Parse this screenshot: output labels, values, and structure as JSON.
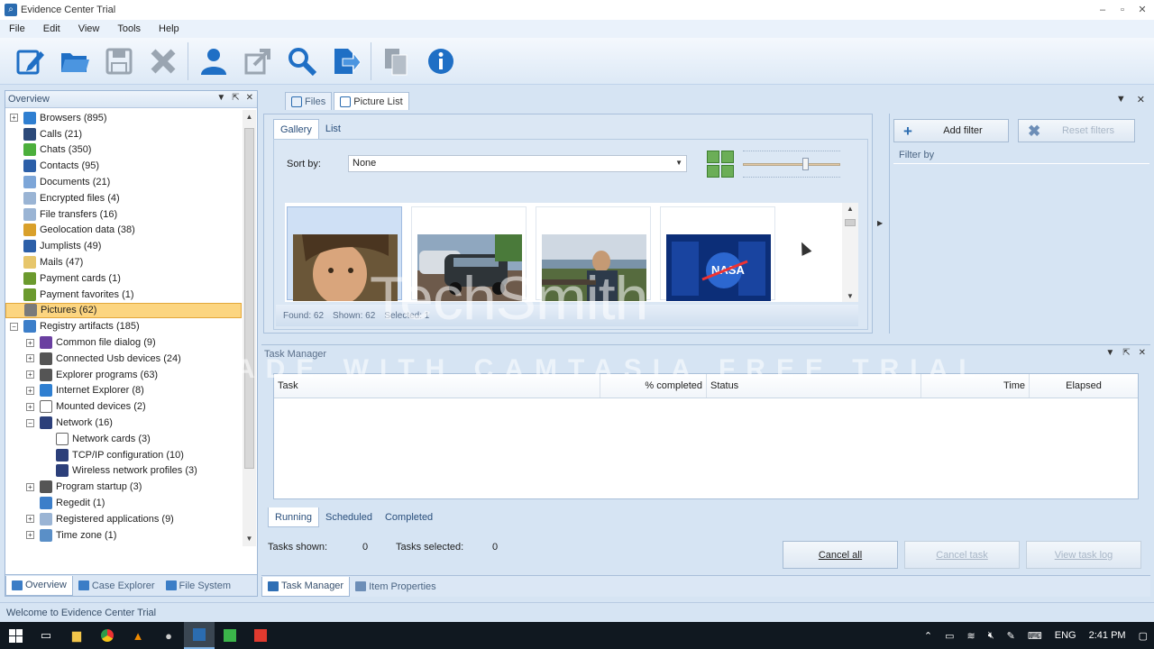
{
  "window": {
    "title": "Evidence Center Trial"
  },
  "menu": [
    "File",
    "Edit",
    "View",
    "Tools",
    "Help"
  ],
  "toolbar": {
    "buttons": [
      {
        "icon": "new-case-icon",
        "color": "#1f6fc5"
      },
      {
        "icon": "open-folder-icon",
        "color": "#1f6fc5"
      },
      {
        "icon": "save-icon",
        "color": "#9aa5b1"
      },
      {
        "icon": "close-x-icon",
        "color": "#9aa5b1"
      },
      {
        "icon": "user-icon",
        "color": "#1f6fc5"
      },
      {
        "icon": "export-icon",
        "color": "#9aa5b1"
      },
      {
        "icon": "search-icon",
        "color": "#1f6fc5"
      },
      {
        "icon": "report-icon",
        "color": "#1f6fc5"
      },
      {
        "icon": "copy-icon",
        "color": "#9aa5b1"
      },
      {
        "icon": "info-icon",
        "color": "#1f6fc5"
      }
    ]
  },
  "overview": {
    "title": "Overview",
    "items": [
      {
        "label": "Browsers (895)",
        "level": 0,
        "expander": "+",
        "icon": "globe-icon",
        "color": "#2f7fd1"
      },
      {
        "label": "Calls (21)",
        "level": 0,
        "expander": "",
        "icon": "phone-icon",
        "color": "#2c4a7a"
      },
      {
        "label": "Chats (350)",
        "level": 0,
        "expander": "",
        "icon": "chat-icon",
        "color": "#4caf3c"
      },
      {
        "label": "Contacts (95)",
        "level": 0,
        "expander": "",
        "icon": "contact-icon",
        "color": "#2c5fa8"
      },
      {
        "label": "Documents (21)",
        "level": 0,
        "expander": "",
        "icon": "document-icon",
        "color": "#7da6d8"
      },
      {
        "label": "Encrypted files (4)",
        "level": 0,
        "expander": "",
        "icon": "lock-file-icon",
        "color": "#9ab4d4"
      },
      {
        "label": "File transfers (16)",
        "level": 0,
        "expander": "",
        "icon": "file-transfer-icon",
        "color": "#9ab4d4"
      },
      {
        "label": "Geolocation data (38)",
        "level": 0,
        "expander": "",
        "icon": "map-icon",
        "color": "#d9a02b"
      },
      {
        "label": "Jumplists (49)",
        "level": 0,
        "expander": "",
        "icon": "jumplist-icon",
        "color": "#2c5fa8"
      },
      {
        "label": "Mails (47)",
        "level": 0,
        "expander": "",
        "icon": "mail-icon",
        "color": "#e7c66b"
      },
      {
        "label": "Payment cards (1)",
        "level": 0,
        "expander": "",
        "icon": "dollar-icon",
        "color": "#6b9a2e"
      },
      {
        "label": "Payment favorites (1)",
        "level": 0,
        "expander": "",
        "icon": "dollar-icon",
        "color": "#6b9a2e"
      },
      {
        "label": "Pictures (62)",
        "level": 0,
        "expander": "",
        "icon": "picture-icon",
        "color": "#7a7a7a",
        "selected": true
      },
      {
        "label": "Registry artifacts (185)",
        "level": 0,
        "expander": "−",
        "icon": "registry-icon",
        "color": "#3c7ec9"
      },
      {
        "label": "Common file dialog (9)",
        "level": 1,
        "expander": "+",
        "icon": "dialog-icon",
        "color": "#6a3fa0"
      },
      {
        "label": "Connected Usb devices (24)",
        "level": 1,
        "expander": "+",
        "icon": "usb-icon",
        "color": "#555555"
      },
      {
        "label": "Explorer programs (63)",
        "level": 1,
        "expander": "+",
        "icon": "explorer-icon",
        "color": "#555555"
      },
      {
        "label": "Internet Explorer (8)",
        "level": 1,
        "expander": "+",
        "icon": "ie-icon",
        "color": "#2f7fd1"
      },
      {
        "label": "Mounted devices (2)",
        "level": 1,
        "expander": "+",
        "icon": "drive-icon",
        "color": "#ffffff"
      },
      {
        "label": "Network (16)",
        "level": 1,
        "expander": "−",
        "icon": "network-icon",
        "color": "#2c3f7a"
      },
      {
        "label": "Network cards (3)",
        "level": 2,
        "expander": "",
        "icon": "card-icon",
        "color": "#ffffff"
      },
      {
        "label": "TCP/IP configuration (10)",
        "level": 2,
        "expander": "",
        "icon": "tcpip-icon",
        "color": "#2c3f7a"
      },
      {
        "label": "Wireless network profiles (3)",
        "level": 2,
        "expander": "",
        "icon": "wireless-icon",
        "color": "#2c3f7a"
      },
      {
        "label": "Program startup (3)",
        "level": 1,
        "expander": "+",
        "icon": "startup-icon",
        "color": "#555555"
      },
      {
        "label": "Regedit (1)",
        "level": 1,
        "expander": "",
        "icon": "regedit-icon",
        "color": "#3c7ec9"
      },
      {
        "label": "Registered applications (9)",
        "level": 1,
        "expander": "+",
        "icon": "apps-icon",
        "color": "#9ab4d4"
      },
      {
        "label": "Time zone (1)",
        "level": 1,
        "expander": "+",
        "icon": "timezone-icon",
        "color": "#5a8fc7"
      }
    ],
    "tabs": [
      "Overview",
      "Case Explorer",
      "File System"
    ]
  },
  "doc": {
    "tabs": [
      "Files",
      "Picture List"
    ],
    "view_tabs": [
      "Gallery",
      "List"
    ],
    "sort_label": "Sort by:",
    "sort_value": "None",
    "status": {
      "found": "Found: 62",
      "shown": "Shown: 62",
      "selected": "Selected: 1"
    }
  },
  "filters": {
    "add_filter": "Add filter",
    "reset_filters": "Reset filters",
    "filter_by": "Filter by"
  },
  "task_manager": {
    "title": "Task Manager",
    "columns": [
      "Task",
      "% completed",
      "Status",
      "Time",
      "Elapsed"
    ],
    "tabs": [
      "Running",
      "Scheduled",
      "Completed"
    ],
    "tasks_shown_label": "Tasks shown:",
    "tasks_shown_value": "0",
    "tasks_selected_label": "Tasks selected:",
    "tasks_selected_value": "0",
    "cancel_all": "Cancel all",
    "cancel_task": "Cancel task",
    "view_task_log": "View task log"
  },
  "bottom_tabs": [
    "Task Manager",
    "Item Properties"
  ],
  "status_bar": "Welcome to Evidence Center Trial",
  "taskbar": {
    "tray": {
      "lang": "ENG",
      "time": "2:41 PM"
    }
  },
  "watermark": {
    "line1": "TechSmith",
    "line2": "MADE WITH CAMTASIA FREE TRIAL"
  }
}
